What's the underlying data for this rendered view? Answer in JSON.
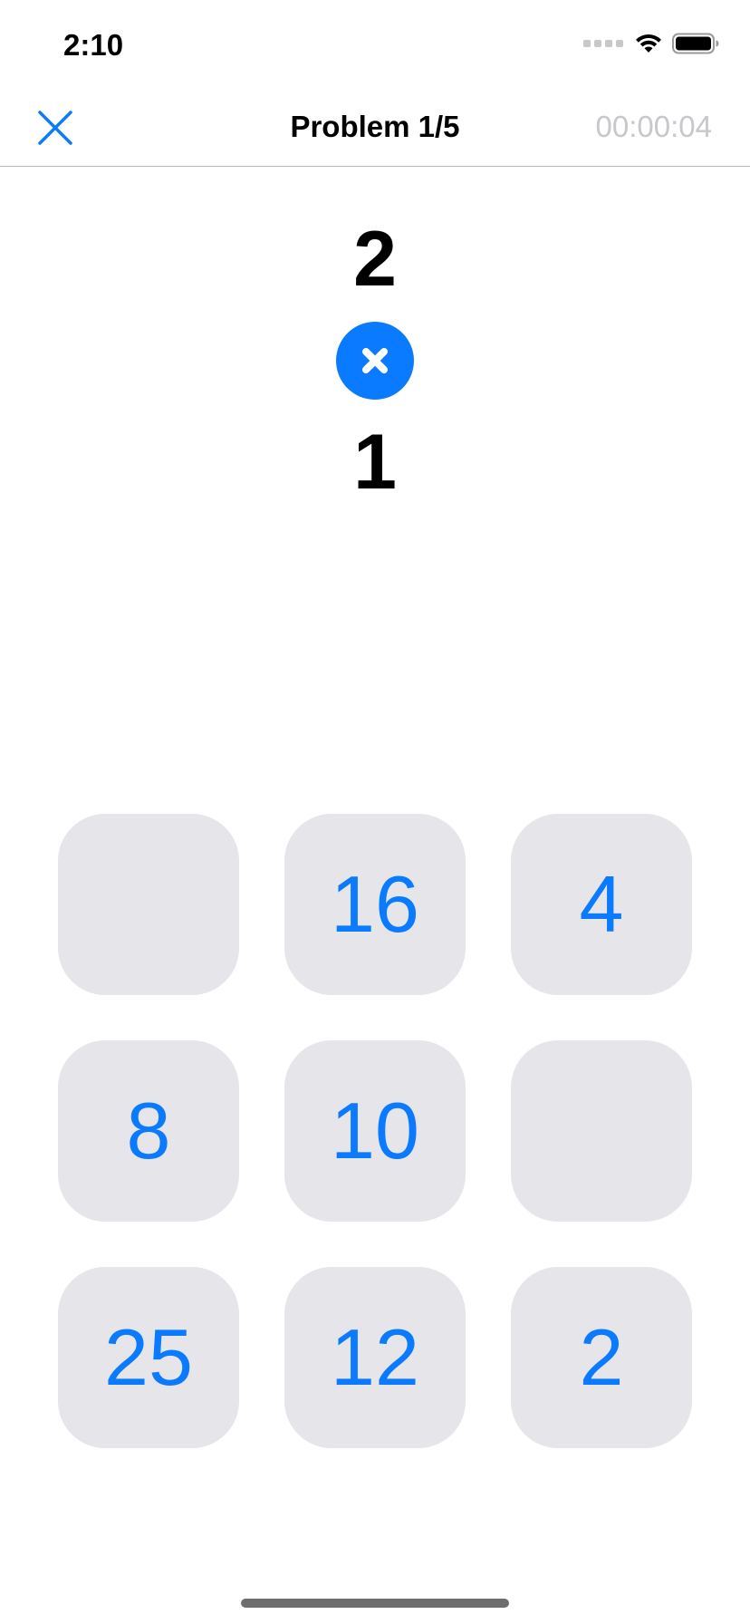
{
  "status_bar": {
    "time": "2:10",
    "icons": [
      "cellular-signal-icon",
      "wifi-icon",
      "battery-icon"
    ]
  },
  "nav": {
    "close_icon": "close-icon",
    "title": "Problem 1/5",
    "timer": "00:00:04"
  },
  "problem": {
    "operand_a": "2",
    "operator_icon": "multiply-icon",
    "operand_b": "1"
  },
  "answers": [
    "",
    "16",
    "4",
    "8",
    "10",
    "",
    "25",
    "12",
    "2"
  ],
  "colors": {
    "accent": "#0a7aff",
    "tile_background": "#e5e5ea",
    "timer_text": "#c7c7cc"
  }
}
